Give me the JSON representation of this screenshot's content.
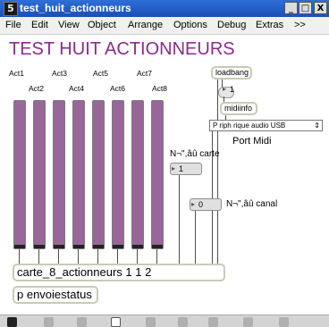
{
  "window": {
    "icon": "5",
    "title": "test_huit_actionneurs",
    "minimize_icon": "_",
    "maximize_icon": "□",
    "close_icon": "X"
  },
  "menu": [
    "File",
    "Edit",
    "View",
    "Object",
    "Arrange",
    "Options",
    "Debug",
    "Extras",
    ">>"
  ],
  "patch": {
    "title": "TEST HUIT ACTIONNEURS",
    "actuators": [
      "Act1",
      "Act2",
      "Act3",
      "Act4",
      "Act5",
      "Act6",
      "Act7",
      "Act8"
    ],
    "carte_object": "carte_8_actionneurs 1 1 2",
    "envoi_object": "p envoiestatus",
    "loadbang": "loadbang",
    "loadbang_value": "1",
    "midiinfo": "midiinfo",
    "port_selected": "P riph rique audio USB",
    "port_label": "Port Midi",
    "carte_label": "N¬\",âû carte",
    "carte_value": "1",
    "canal_label": "N¬\",âû canal",
    "canal_value": "0"
  }
}
